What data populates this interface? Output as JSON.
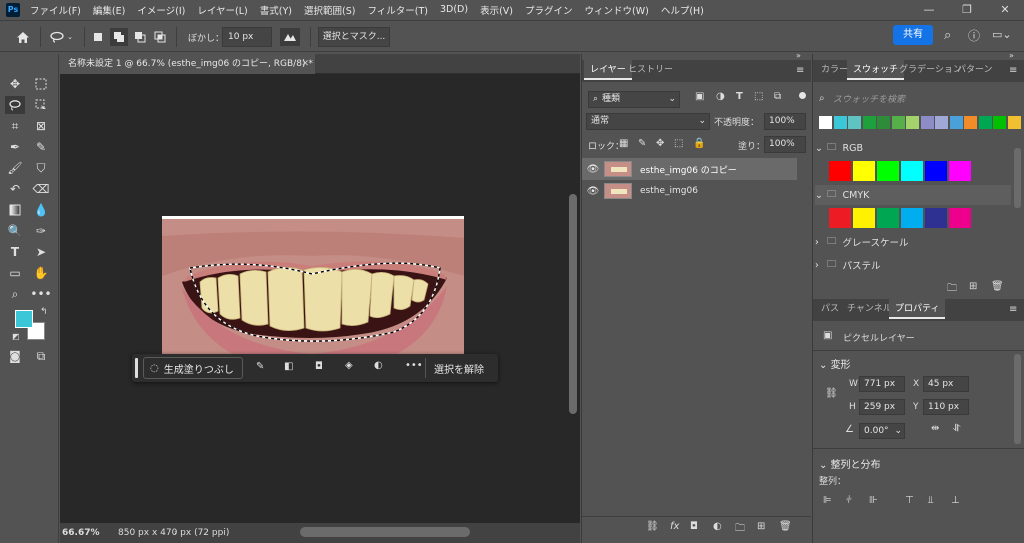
{
  "app": {
    "logo": "Ps"
  },
  "menu": [
    "ファイル(F)",
    "編集(E)",
    "イメージ(I)",
    "レイヤー(L)",
    "書式(Y)",
    "選択範囲(S)",
    "フィルター(T)",
    "3D(D)",
    "表示(V)",
    "プラグイン",
    "ウィンドウ(W)",
    "ヘルプ(H)"
  ],
  "options": {
    "feather_label": "ぼかし：",
    "feather_value": "10 px",
    "select_mask_label": "選択とマスク...",
    "share_label": "共有"
  },
  "document": {
    "tab_title": "名称未設定 1 @ 66.7% (esthe_img06 のコピー, RGB/8) *",
    "zoom": "66.67%",
    "info": "850 px x 470 px (72 ppi)"
  },
  "context_bar": {
    "generative_fill": "生成塗りつぶし",
    "deselect": "選択を解除"
  },
  "layers_panel": {
    "tabs": [
      "レイヤー",
      "ヒストリー"
    ],
    "filter_kind": "種類",
    "blend_mode": "通常",
    "opacity_label": "不透明度：",
    "opacity_value": "100%",
    "lock_label": "ロック：",
    "fill_label": "塗り：",
    "fill_value": "100%",
    "layers": [
      {
        "name": "esthe_img06 のコピー",
        "selected": true
      },
      {
        "name": "esthe_img06",
        "selected": false
      }
    ]
  },
  "swatches_panel": {
    "tabs": [
      "カラー",
      "スウォッチ",
      "グラデーション",
      "パターン"
    ],
    "search_placeholder": "スウォッチを検索",
    "recent": [
      "#ffffff",
      "#3cc7d8",
      "#5fc3c1",
      "#1ea03c",
      "#2e8b3a",
      "#55b04a",
      "#a5d36b",
      "#8e8cc7",
      "#a0a8d8",
      "#4aa0d8",
      "#f28c28",
      "#00a651",
      "#00c000",
      "#f0c030"
    ],
    "groups": [
      {
        "name": "RGB",
        "colors": [
          "#ff0000",
          "#ffff00",
          "#00ff00",
          "#00ffff",
          "#0000ff",
          "#ff00ff"
        ]
      },
      {
        "name": "CMYK",
        "colors": [
          "#ed1c24",
          "#fff200",
          "#00a651",
          "#00aeef",
          "#2e3192",
          "#ec008c"
        ]
      },
      {
        "name": "グレースケール"
      },
      {
        "name": "パステル"
      }
    ]
  },
  "properties_panel": {
    "tabs": [
      "パス",
      "チャンネル",
      "プロパティ"
    ],
    "layer_type": "ピクセルレイヤー",
    "transform_title": "変形",
    "w_label": "W",
    "w_value": "771 px",
    "h_label": "H",
    "h_value": "259 px",
    "x_label": "X",
    "x_value": "45 px",
    "y_label": "Y",
    "y_value": "110 px",
    "angle_value": "0.00°",
    "align_title": "整列と分布",
    "align_label": "整列："
  },
  "colors": {
    "foreground": "#3cc7d8",
    "background": "#ffffff",
    "accent": "#1473e6"
  }
}
